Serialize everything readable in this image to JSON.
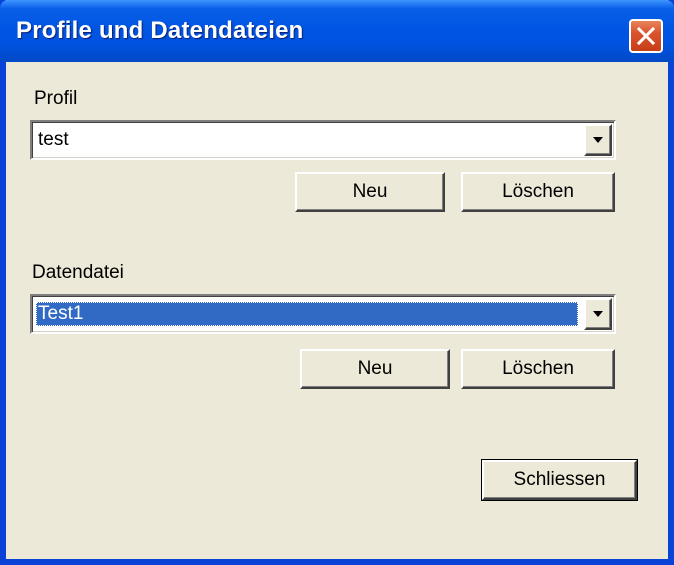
{
  "window": {
    "title": "Profile und Datendateien",
    "close_icon": "close-icon"
  },
  "profile": {
    "label": "Profil",
    "selected_value": "test",
    "new_label": "Neu",
    "delete_label": "Löschen"
  },
  "datafile": {
    "label": "Datendatei",
    "selected_value": "Test1",
    "new_label": "Neu",
    "delete_label": "Löschen"
  },
  "footer": {
    "close_label": "Schliessen"
  },
  "colors": {
    "titlebar": "#0055e3",
    "window_bg": "#ece9d8",
    "selection": "#316ac5",
    "close_button": "#d9542d"
  }
}
